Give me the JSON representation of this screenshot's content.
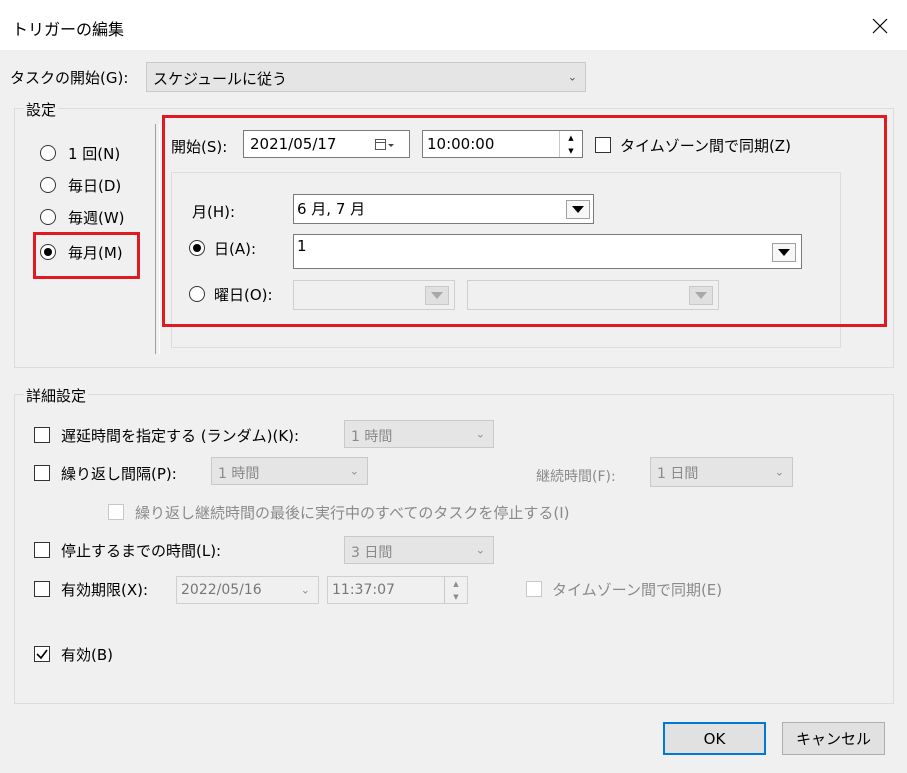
{
  "window": {
    "title": "トリガーの編集"
  },
  "task_start": {
    "label": "タスクの開始(G):",
    "value": "スケジュールに従う"
  },
  "settings": {
    "legend": "設定",
    "schedule_options": [
      {
        "label": "1 回(N)",
        "selected": false
      },
      {
        "label": "毎日(D)",
        "selected": false
      },
      {
        "label": "毎週(W)",
        "selected": false
      },
      {
        "label": "毎月(M)",
        "selected": true
      }
    ],
    "start": {
      "label": "開始(S):",
      "date": "2021/05/17",
      "time": "10:00:00"
    },
    "timezone_sync": {
      "label": "タイムゾーン間で同期(Z)",
      "checked": false
    },
    "monthly": {
      "months_label": "月(H):",
      "months_value": "6 月, 7 月",
      "days_label": "日(A):",
      "days_value": "1",
      "days_selected": true,
      "weekday_label": "曜日(O):",
      "weekday_selected": false
    }
  },
  "advanced": {
    "legend": "詳細設定",
    "delay": {
      "label": "遅延時間を指定する (ランダム)(K):",
      "value": "1 時間",
      "checked": false
    },
    "repeat": {
      "label": "繰り返し間隔(P):",
      "value": "1 時間",
      "checked": false,
      "duration_label": "継続時間(F):",
      "duration_value": "1 日間"
    },
    "stop_all": {
      "label": "繰り返し継続時間の最後に実行中のすべてのタスクを停止する(I)",
      "checked": false
    },
    "stop_after": {
      "label": "停止するまでの時間(L):",
      "value": "3 日間",
      "checked": false
    },
    "expire": {
      "label": "有効期限(X):",
      "date": "2022/05/16",
      "time": "11:37:07",
      "checked": false
    },
    "expire_tz": {
      "label": "タイムゾーン間で同期(E)",
      "checked": false
    },
    "enabled": {
      "label": "有効(B)",
      "checked": true
    }
  },
  "buttons": {
    "ok": "OK",
    "cancel": "キャンセル"
  },
  "colors": {
    "highlight": "#e01a22",
    "default_button_border": "#0078d7"
  }
}
